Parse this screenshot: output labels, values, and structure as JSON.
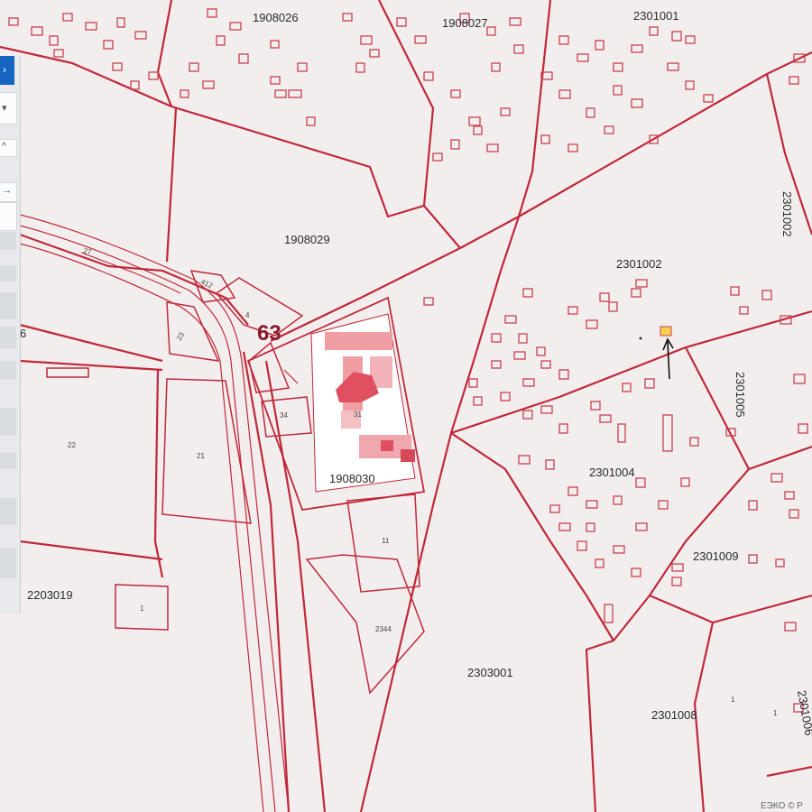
{
  "map": {
    "colors": {
      "background": "#f3eeee",
      "boundary": "#c0283a",
      "building": "#c84050",
      "building_fill": "#e9757f",
      "highlight": "#f5d050",
      "arrow": "#101010"
    },
    "parcel_labels": {
      "p1908026": "1908026",
      "p1908027": "1908027",
      "p2301001": "2301001",
      "p1908029": "1908029",
      "p2301002_a": "2301002",
      "p2301002_b": "2301002",
      "p1908030": "1908030",
      "p2301004": "2301004",
      "p2301005": "2301005",
      "p2301009": "2301009",
      "p2203019": "2203019",
      "p2303001": "2303001",
      "p2301008": "2301008",
      "p2301006": "2301006"
    },
    "plot_numbers": {
      "n22": "22",
      "n21": "21",
      "n23": "23",
      "n4": "4",
      "n412": "412",
      "n34": "34",
      "n31": "31",
      "n11": "11",
      "n2344": "2344",
      "n1_left": "1",
      "n1_right": "1",
      "n1_far": "1",
      "n27": "27",
      "n6": "6"
    },
    "quarter_number": "63",
    "copyright": "ЕЭКО © Р"
  },
  "panel": {
    "icons": {
      "collapse": "chevron-left-icon",
      "dropdown": "chevron-down-icon",
      "link": "arrow-right-icon"
    }
  }
}
